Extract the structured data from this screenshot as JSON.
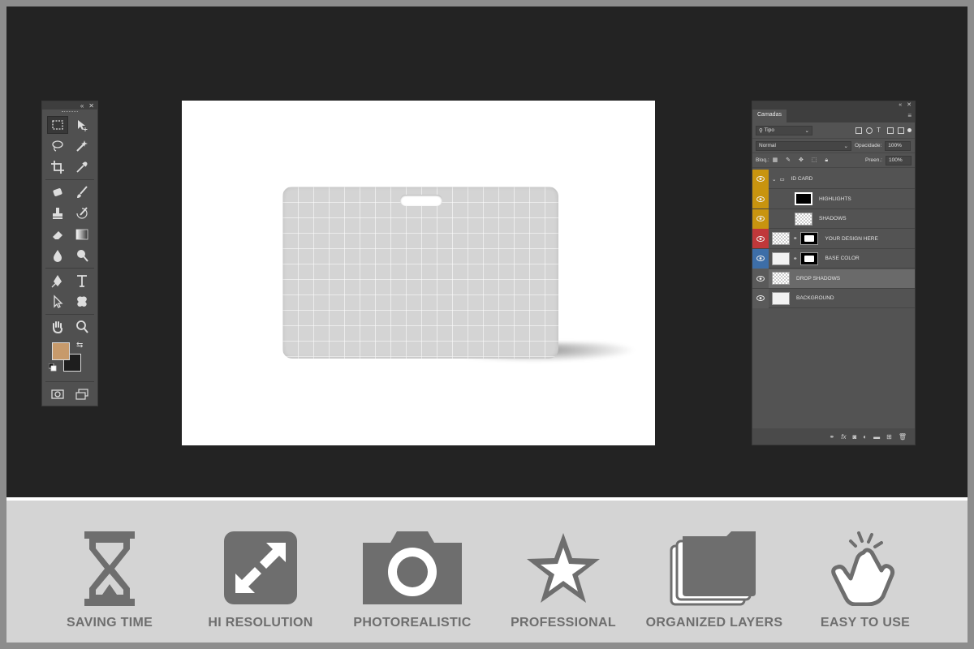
{
  "layers_panel": {
    "tab": "Camadas",
    "filter_kind": "Tipo",
    "blend_mode": "Normal",
    "opacity_label": "Opacidade:",
    "opacity_value": "100%",
    "lock_label": "Bloq.:",
    "fill_label": "Preen.:",
    "fill_value": "100%",
    "layers": [
      {
        "name": "ID CARD",
        "color": "#c8940f",
        "type": "group"
      },
      {
        "name": "HIGHLIGHTS",
        "color": "#c8940f",
        "type": "layer"
      },
      {
        "name": "SHADOWS",
        "color": "#c8940f",
        "type": "layer"
      },
      {
        "name": "YOUR DESIGN HERE",
        "color": "#c0383a",
        "type": "smart"
      },
      {
        "name": "BASE COLOR",
        "color": "#3d6ea8",
        "type": "masked"
      },
      {
        "name": "DROP SHADOWS",
        "color": "#5a5a5a",
        "type": "layer",
        "selected": true
      },
      {
        "name": "BACKGROUND",
        "color": "#5a5a5a",
        "type": "layer"
      }
    ]
  },
  "tools": {
    "foreground_color": "#c79a6b",
    "background_color": "#1e1e1e"
  },
  "features": [
    {
      "label": "SAVING TIME",
      "icon": "hourglass-icon"
    },
    {
      "label": "HI RESOLUTION",
      "icon": "expand-arrows-icon"
    },
    {
      "label": "PHOTOREALISTIC",
      "icon": "camera-icon"
    },
    {
      "label": "PROFESSIONAL",
      "icon": "star-icon"
    },
    {
      "label": "ORGANIZED LAYERS",
      "icon": "folders-icon"
    },
    {
      "label": "EASY TO USE",
      "icon": "hand-tap-icon"
    }
  ]
}
